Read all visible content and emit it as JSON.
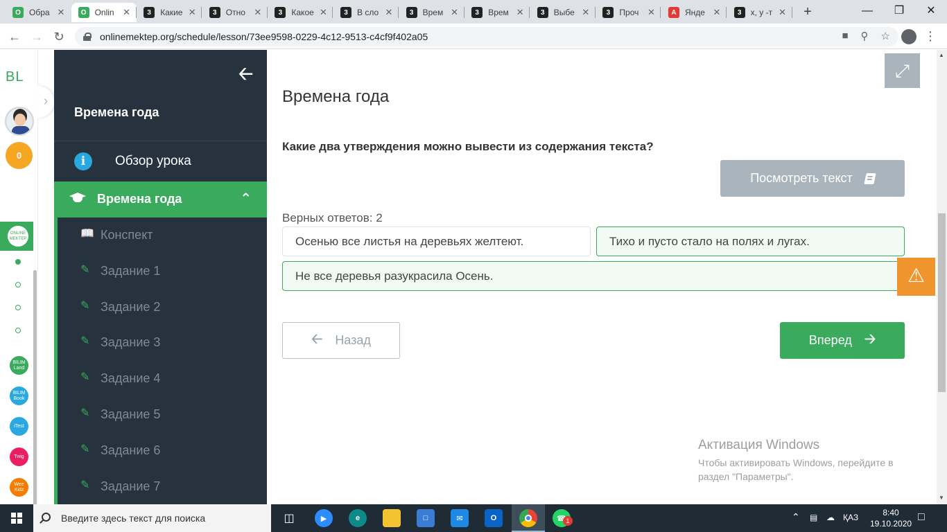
{
  "browser": {
    "tabs": [
      {
        "title": "Обра",
        "fav": "O",
        "color": "#3aaa5c"
      },
      {
        "title": "Onlin",
        "fav": "O",
        "color": "#3aaa5c"
      },
      {
        "title": "Какие",
        "fav": "3",
        "color": "#222222"
      },
      {
        "title": "Отно",
        "fav": "3",
        "color": "#222222"
      },
      {
        "title": "Какое",
        "fav": "3",
        "color": "#222222"
      },
      {
        "title": "В сло",
        "fav": "3",
        "color": "#222222"
      },
      {
        "title": "Врем",
        "fav": "3",
        "color": "#222222"
      },
      {
        "title": "Врем",
        "fav": "3",
        "color": "#222222"
      },
      {
        "title": "Выбе",
        "fav": "3",
        "color": "#222222"
      },
      {
        "title": "Проч",
        "fav": "3",
        "color": "#222222"
      },
      {
        "title": "Янде",
        "fav": "A",
        "color": "#e53935"
      },
      {
        "title": "x, y -т",
        "fav": "3",
        "color": "#222222"
      }
    ],
    "url": "onlinemektep.org/schedule/lesson/73ee9598-0229-4c12-9513-c4cf9f402a05"
  },
  "rail": {
    "logo": "BL",
    "coins": "0",
    "active_app": "ONLINE MEKTEP",
    "apps": [
      {
        "name": "BilimLand",
        "label": "BILIM Land",
        "color": "#3aaa5c"
      },
      {
        "name": "BilimBook",
        "label": "BILIM Book",
        "color": "#29a8e0"
      },
      {
        "name": "iTest",
        "label": "iTest",
        "color": "#29a8e0"
      },
      {
        "name": "Twig",
        "label": "Twig",
        "color": "#e91e63"
      },
      {
        "name": "Tilly",
        "label": "Wee Kidz",
        "color": "#f57c00"
      }
    ]
  },
  "sidebar": {
    "lesson_title": "Времена года",
    "overview_label": "Обзор урока",
    "section_label": "Времена года",
    "items": [
      {
        "label": "Конспект",
        "icon": "book-open-icon"
      },
      {
        "label": "Задание 1",
        "icon": "edit-icon"
      },
      {
        "label": "Задание 2",
        "icon": "edit-icon"
      },
      {
        "label": "Задание 3",
        "icon": "edit-icon"
      },
      {
        "label": "Задание 4",
        "icon": "edit-icon"
      },
      {
        "label": "Задание 5",
        "icon": "edit-icon"
      },
      {
        "label": "Задание 6",
        "icon": "edit-icon"
      },
      {
        "label": "Задание 7",
        "icon": "edit-icon"
      }
    ]
  },
  "main": {
    "page_title": "Времена года",
    "question": "Какие два утверждения можно вывести из содержания текста?",
    "view_text_button": "Посмотреть текст",
    "answers_count": "Верных ответов: 2",
    "options": [
      {
        "text": "Осенью все листья на деревьях желтеют.",
        "selected": false
      },
      {
        "text": "Тихо и пусто стало на полях и лугах.",
        "selected": true
      },
      {
        "text": "Не все деревья разукрасила Осень.",
        "selected": true
      }
    ],
    "back_button": "Назад",
    "next_button": "Вперед"
  },
  "activation": {
    "title": "Активация Windows",
    "text": "Чтобы активировать Windows, перейдите в раздел \"Параметры\"."
  },
  "taskbar": {
    "search_placeholder": "Введите здесь текст для поиска",
    "lang": "ҚАЗ",
    "time": "8:40",
    "date": "19.10.2020",
    "whatsapp_badge": "1"
  },
  "colors": {
    "accent": "#3aaa5c",
    "sidebar_bg": "#26333f",
    "button_grey": "#aab4bd",
    "warning": "#f0952d"
  }
}
